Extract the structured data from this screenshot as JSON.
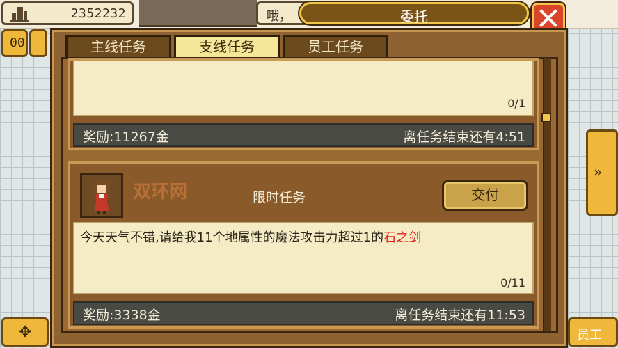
{
  "hud": {
    "money": "2352232",
    "message": "哦，",
    "title": "委托"
  },
  "tabs": [
    {
      "label": "主线任务",
      "active": false
    },
    {
      "label": "支线任务",
      "active": true
    },
    {
      "label": "员工任务",
      "active": false
    }
  ],
  "quests": [
    {
      "progress": "0/1",
      "reward": "奖励:11267金",
      "time_left": "离任务结束还有4:51"
    },
    {
      "watermark": "双环网",
      "type": "限时任务",
      "submit_label": "交付",
      "description": "今天天气不错,请给我11个地属性的魔法攻击力超过1的",
      "item_name": "石之剑",
      "progress": "0/11",
      "reward": "奖励:3338金",
      "time_left": "离任务结束还有11:53"
    }
  ],
  "side_buttons": {
    "pause": "00",
    "next": "»",
    "dpad": "✥",
    "staff": "员工"
  },
  "colors": {
    "panel": "#8e6233",
    "title_bar": "#7a5416",
    "gold_border": "#f0c64a",
    "close": "#d8452a",
    "item_highlight": "#e01e1e"
  }
}
